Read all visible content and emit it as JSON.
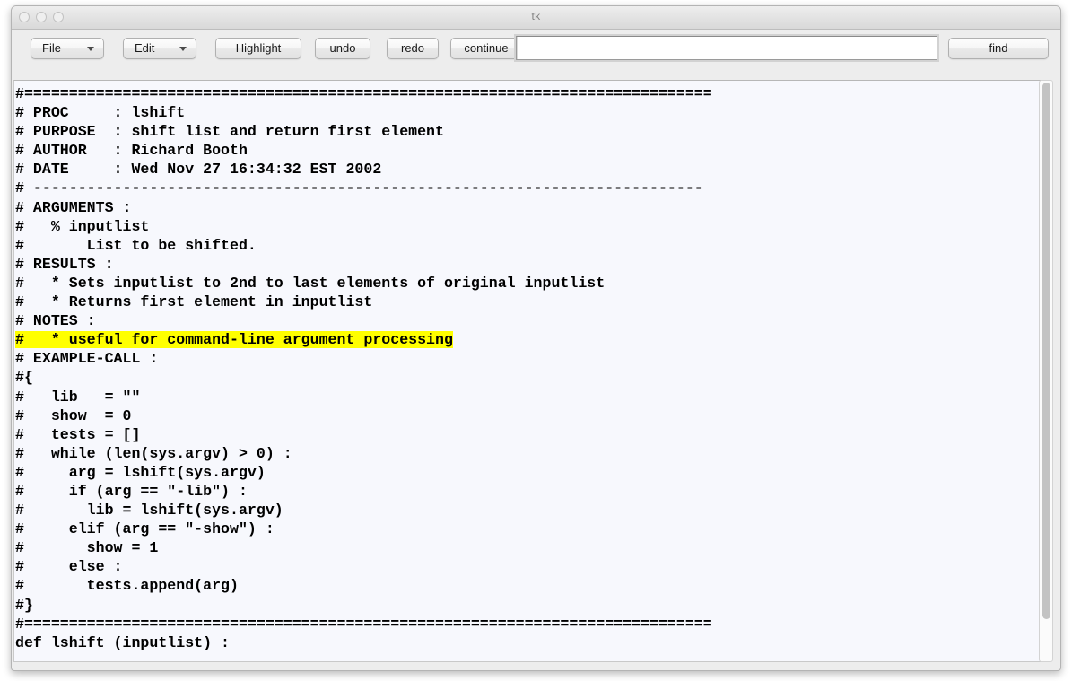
{
  "window": {
    "title": "tk",
    "traffic_lights": [
      "close",
      "minimize",
      "zoom"
    ]
  },
  "toolbar": {
    "file_menu_label": "File",
    "edit_menu_label": "Edit",
    "highlight_label": "Highlight",
    "undo_label": "undo",
    "redo_label": "redo",
    "continue_label": "continue",
    "find_label": "find",
    "find_input_value": "",
    "find_input_placeholder": ""
  },
  "editor": {
    "background_color": "#f7f8fd",
    "highlight_color": "#ffff00",
    "text_color": "#000000",
    "lines": [
      "#=============================================================================",
      "# PROC     : lshift",
      "# PURPOSE  : shift list and return first element",
      "# AUTHOR   : Richard Booth",
      "# DATE     : Wed Nov 27 16:34:32 EST 2002",
      "# ---------------------------------------------------------------------------",
      "# ARGUMENTS :",
      "#   % inputlist",
      "#       List to be shifted.",
      "# RESULTS :",
      "#   * Sets inputlist to 2nd to last elements of original inputlist",
      "#   * Returns first element in inputlist",
      "# NOTES :",
      "#   * useful for command-line argument processing",
      "# EXAMPLE-CALL :",
      "#{",
      "#   lib   = \"\"",
      "#   show  = 0",
      "#   tests = []",
      "#   while (len(sys.argv) > 0) :",
      "#     arg = lshift(sys.argv)",
      "#     if (arg == \"-lib\") :",
      "#       lib = lshift(sys.argv)",
      "#     elif (arg == \"-show\") :",
      "#       show = 1",
      "#     else :",
      "#       tests.append(arg)",
      "#}",
      "#=============================================================================",
      "def lshift (inputlist) :"
    ],
    "highlighted_line_index": 13,
    "highlighted_line_text": "#   * useful for command-line argument processing",
    "scrollbar": {
      "thumb_position": "top",
      "thumb_fraction": 0.93
    }
  }
}
